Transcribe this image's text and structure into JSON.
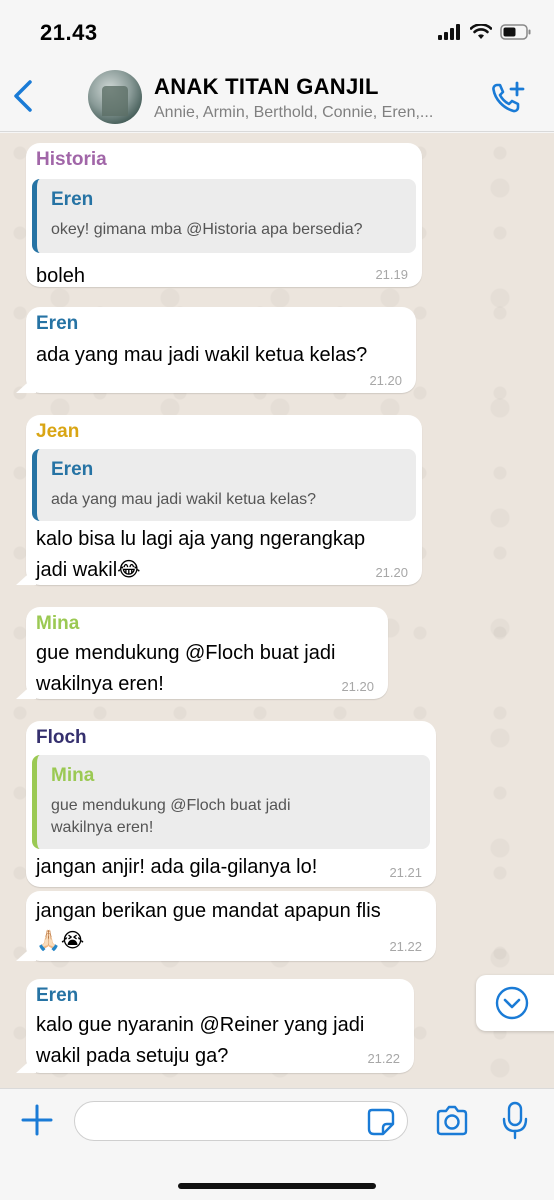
{
  "status": {
    "time": "21.43",
    "icons": [
      "signal-icon",
      "wifi-icon",
      "battery-icon"
    ]
  },
  "header": {
    "title": "ANAK TITAN GANJIL",
    "members": "Annie, Armin, Berthold, Connie, Eren,...",
    "icons": [
      "back-chevron-icon",
      "group-avatar",
      "add-call-icon"
    ]
  },
  "messages": [
    {
      "sender": "Historia",
      "sender_color": "#a166a8",
      "quote": {
        "sender": "Eren",
        "sender_color": "#2673a4",
        "text": "okey! gimana mba @Historia apa bersedia?"
      },
      "text": "boleh",
      "time": "21.19"
    },
    {
      "sender": "Eren",
      "sender_color": "#2673a4",
      "text": "ada yang mau jadi wakil ketua kelas?",
      "time": "21.20"
    },
    {
      "sender": "Jean",
      "sender_color": "#d9a514",
      "quote": {
        "sender": "Eren",
        "sender_color": "#2673a4",
        "text": "ada yang mau jadi wakil ketua kelas?"
      },
      "text_line1": "kalo bisa lu lagi aja yang ngerangkap",
      "text_line2": "jadi wakil😂",
      "time": "21.20"
    },
    {
      "sender": "Mina",
      "sender_color": "#9bc953",
      "text_line1": "gue mendukung @Floch buat jadi",
      "text_line2": "wakilnya eren!",
      "time": "21.20"
    },
    {
      "sender": "Floch",
      "sender_color": "#35306e",
      "quote": {
        "sender": "Mina",
        "sender_color": "#9bc953",
        "text_line1": "gue mendukung @Floch buat jadi",
        "text_line2": "wakilnya eren!"
      },
      "text": "jangan anjir! ada gila-gilanya lo!",
      "time": "21.21"
    },
    {
      "text_line1": "jangan berikan gue mandat apapun flis",
      "text_line2": "🙏🏻😭",
      "time": "21.22"
    },
    {
      "sender": "Eren",
      "sender_color": "#2673a4",
      "text_line1": "kalo gue nyaranin @Reiner yang jadi",
      "text_line2": "wakil pada setuju ga?",
      "time": "21.22"
    }
  ],
  "composer": {
    "value": "",
    "icons": [
      "plus-icon",
      "sticker-icon",
      "camera-icon",
      "microphone-icon",
      "scroll-down-icon"
    ]
  },
  "colors": {
    "accent": "#1a7bd6",
    "chat_bg": "#ece5dd",
    "bubble": "#ffffff"
  }
}
